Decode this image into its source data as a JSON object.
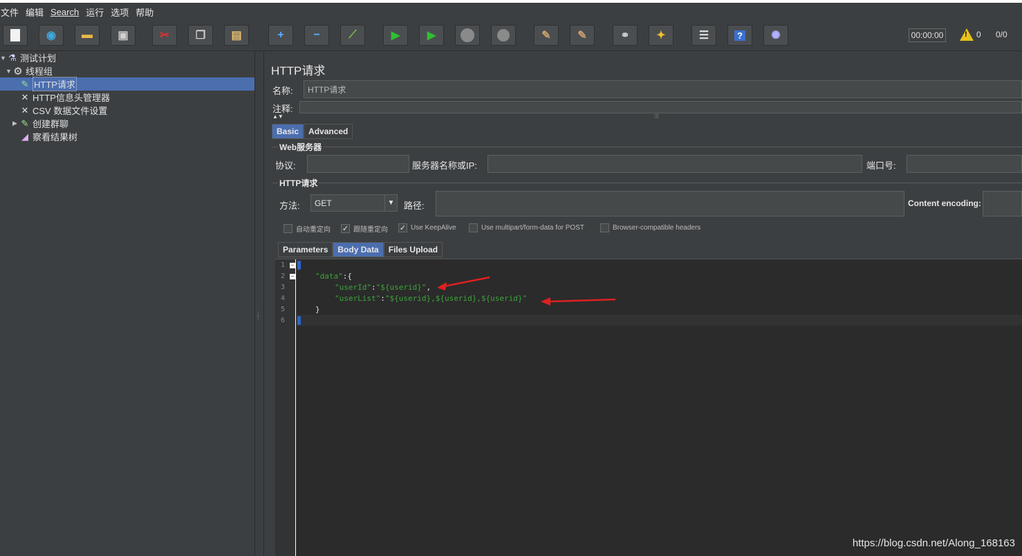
{
  "menu": [
    "文件",
    "编辑",
    "Search",
    "运行",
    "选项",
    "帮助"
  ],
  "toolbar": {
    "buttons": [
      "new-icon",
      "templates-icon",
      "open-icon",
      "save-icon",
      "cut-icon",
      "copy-icon",
      "paste-icon",
      "expand-icon",
      "collapse-icon",
      "toggle-icon",
      "start-icon",
      "start-no-pauses-icon",
      "stop-icon",
      "shutdown-icon",
      "clear-icon",
      "clear-all-icon",
      "search-icon",
      "reset-search-icon",
      "function-helper-icon",
      "help-icon",
      "remote-icon"
    ],
    "timer": "00:00:00",
    "warn_count": "0",
    "ratio": "0/0"
  },
  "tree": [
    {
      "label": "测试计划",
      "icon": "flask-icon",
      "depth": 0,
      "arrow": "▼"
    },
    {
      "label": "线程组",
      "icon": "gear-icon",
      "depth": 1,
      "arrow": "▼"
    },
    {
      "label": "HTTP请求",
      "icon": "pipette-icon",
      "depth": 2,
      "arrow": "",
      "selected": true
    },
    {
      "label": "HTTP信息头管理器",
      "icon": "wrench-icon",
      "depth": 2,
      "arrow": ""
    },
    {
      "label": "CSV 数据文件设置",
      "icon": "wrench-icon",
      "depth": 2,
      "arrow": ""
    },
    {
      "label": "创建群聊",
      "icon": "pipette-icon",
      "depth": 2,
      "arrow": "▶"
    },
    {
      "label": "察看结果树",
      "icon": "chart-icon",
      "depth": 2,
      "arrow": ""
    }
  ],
  "panel": {
    "title": "HTTP请求",
    "name_label": "名称:",
    "name_value": "HTTP请求",
    "comment_label": "注释:",
    "tabs": [
      "Basic",
      "Advanced"
    ],
    "web_server_group": "Web服务器",
    "protocol_label": "协议:",
    "server_label": "服务器名称或IP:",
    "port_label": "端口号:",
    "http_group": "HTTP请求",
    "method_label": "方法:",
    "method_value": "GET",
    "path_label": "路径:",
    "encoding_label": "Content encoding:",
    "checkboxes": [
      {
        "label": "自动重定向",
        "checked": false
      },
      {
        "label": "跟随重定向",
        "checked": true
      },
      {
        "label": "Use KeepAlive",
        "checked": true
      },
      {
        "label": "Use multipart/form-data for POST",
        "checked": false
      },
      {
        "label": "Browser-compatible headers",
        "checked": false
      }
    ],
    "body_tabs": [
      "Parameters",
      "Body Data",
      "Files Upload"
    ]
  },
  "editor": {
    "line_numbers": [
      "1",
      "2",
      "3",
      "4",
      "5",
      "6"
    ],
    "lines": [
      {
        "text": "{"
      },
      {
        "key": "\"data\"",
        "rest": ":{"
      },
      {
        "key": "\"userId\"",
        "sep": ":",
        "val": "\"${userid}\"",
        "rest": ","
      },
      {
        "key": "\"userList\"",
        "sep": ":",
        "val": "\"${userid},${userid},${userid}\""
      },
      {
        "text": "}"
      },
      {
        "text": "}"
      }
    ]
  },
  "watermark": "https://blog.csdn.net/Along_168163",
  "colors": {
    "accent": "#4b6eaf",
    "arrow": "#e02020"
  }
}
